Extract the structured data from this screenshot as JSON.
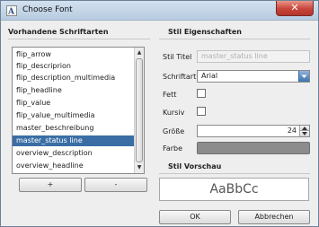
{
  "window": {
    "title": "Choose Font",
    "close_symbol": "✕",
    "icons": {
      "app": "font-dialog-icon",
      "close": "close-icon"
    }
  },
  "left_panel": {
    "heading": "Vorhandene Schriftarten",
    "items": [
      "flip_arrow",
      "flip_descriprion",
      "flip_description_multimedia",
      "flip_headline",
      "flip_value",
      "flip_value_multimedia",
      "master_beschreibung",
      "master_status line",
      "overview_description",
      "overview_headline"
    ],
    "selected_item": "master_status line",
    "add_label": "+",
    "remove_label": "-"
  },
  "right_panel": {
    "heading": "Stil Eigenschaften",
    "fields": {
      "stil_titel": {
        "label": "Stil Titel",
        "placeholder": "master_status line"
      },
      "schriftart": {
        "label": "Schriftart",
        "value": "Arial"
      },
      "fett": {
        "label": "Fett",
        "checked": false
      },
      "kursiv": {
        "label": "Kursiv",
        "checked": false
      },
      "groesse": {
        "label": "Größe",
        "value": "24"
      },
      "farbe": {
        "label": "Farbe",
        "color": "#8c8c8c"
      }
    },
    "preview_heading": "Stil Vorschau",
    "preview_text": "AaBbCc"
  },
  "footer": {
    "ok_label": "OK",
    "cancel_label": "Abbrechen"
  },
  "colors": {
    "selection": "#3a6ea5",
    "close_button": "#c8453a",
    "combo_arrow": "#3f74b0"
  }
}
